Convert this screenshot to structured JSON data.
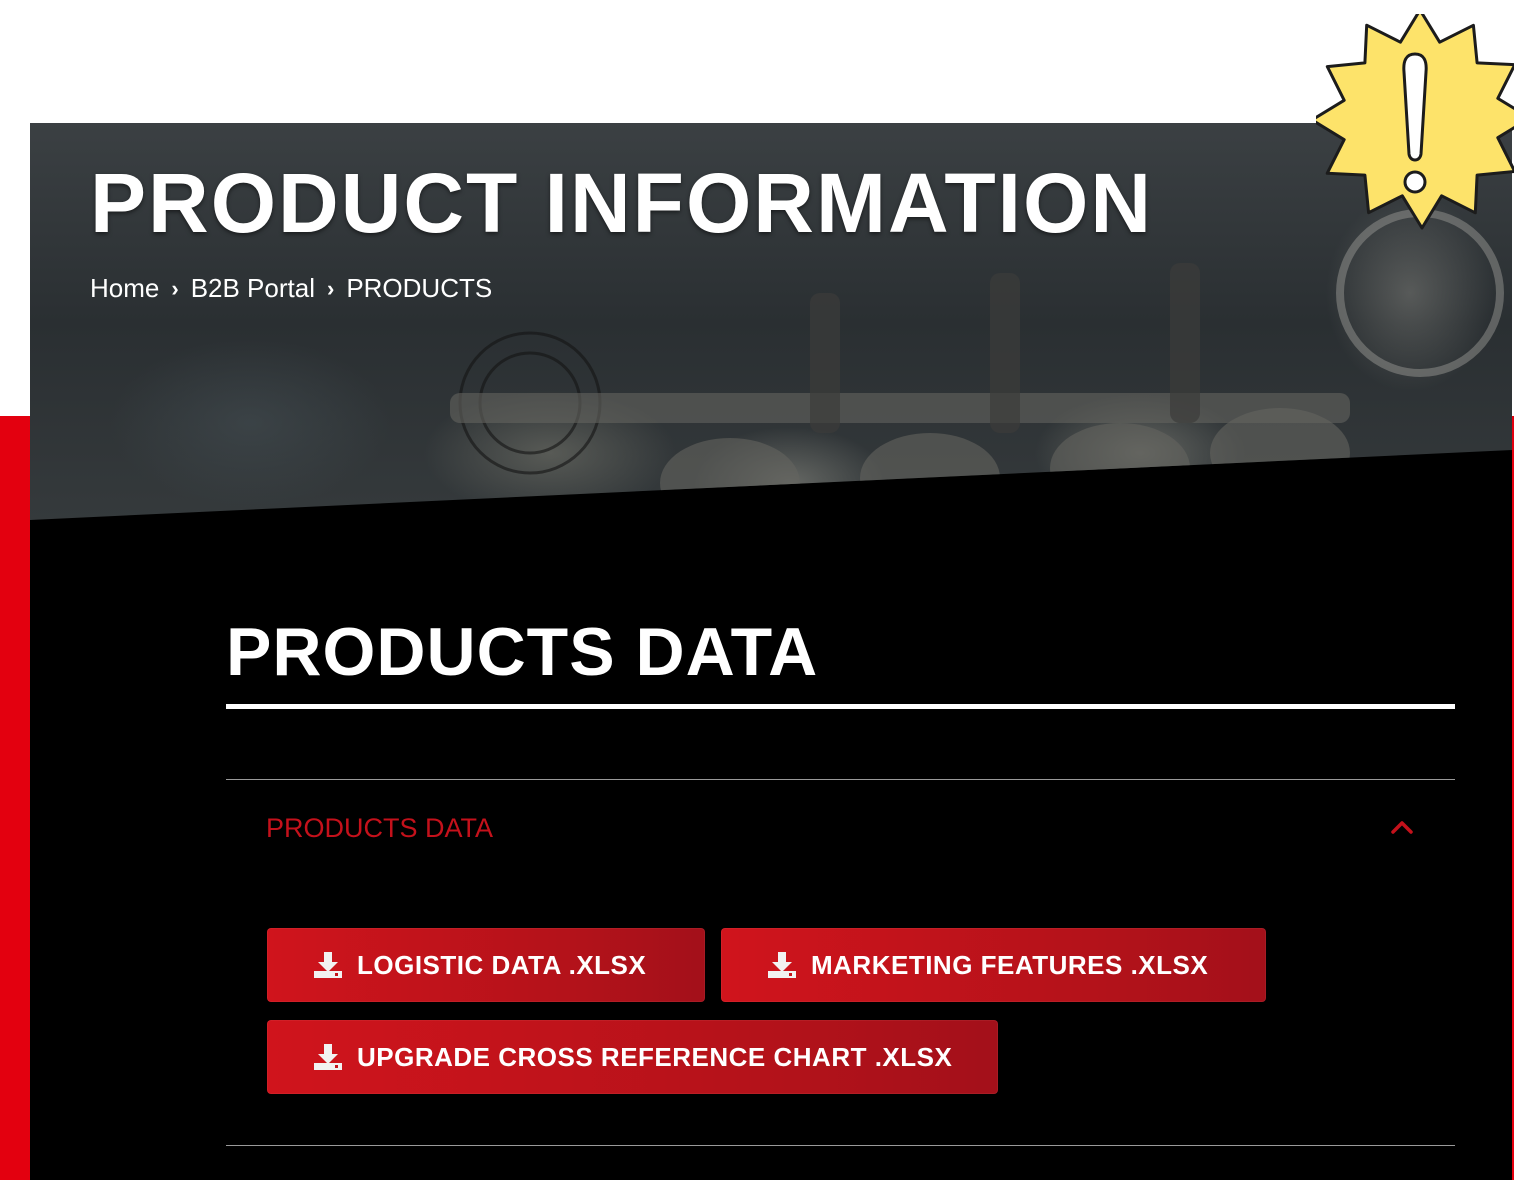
{
  "hero": {
    "title": "PRODUCT INFORMATION",
    "breadcrumb": [
      "Home",
      "B2B Portal",
      "PRODUCTS"
    ],
    "separator": "›"
  },
  "section": {
    "title": "PRODUCTS DATA"
  },
  "accordion": {
    "label": "PRODUCTS DATA",
    "expanded": true,
    "icon": "chevron-up-icon"
  },
  "downloads": [
    {
      "label": "LOGISTIC DATA .XLSX",
      "icon": "download-icon"
    },
    {
      "label": "MARKETING FEATURES .XLSX",
      "icon": "download-icon"
    },
    {
      "label": "UPGRADE CROSS REFERENCE CHART .XLSX",
      "icon": "download-icon"
    }
  ],
  "badge": {
    "icon": "alert-exclamation-icon"
  },
  "colors": {
    "accent_red": "#e3000f",
    "button_red": "#c4141c",
    "label_red": "#c4111b",
    "badge_yellow": "#fde36a",
    "panel_bg": "#000000"
  }
}
